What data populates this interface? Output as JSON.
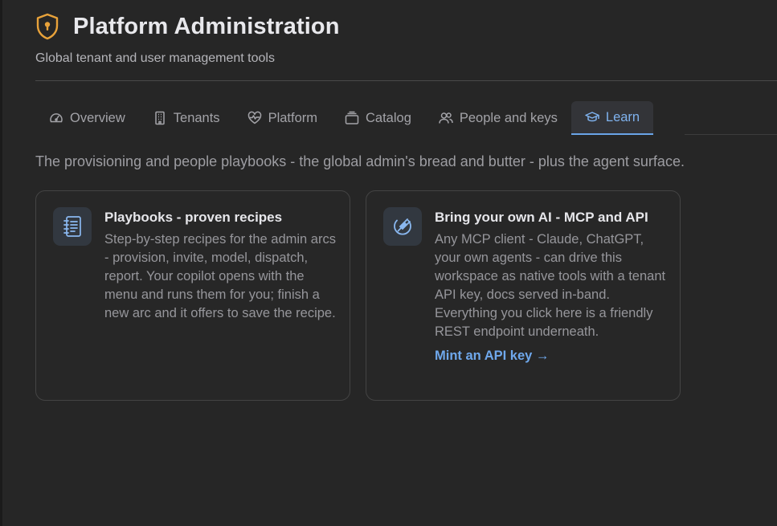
{
  "header": {
    "title": "Platform Administration",
    "subtitle": "Global tenant and user management tools",
    "icon": "shield-keyhole-icon",
    "accent_color": "#e8a23a"
  },
  "tabs": [
    {
      "label": "Overview",
      "icon": "gauge-icon",
      "active": false
    },
    {
      "label": "Tenants",
      "icon": "building-icon",
      "active": false
    },
    {
      "label": "Platform",
      "icon": "heart-pulse-icon",
      "active": false
    },
    {
      "label": "Catalog",
      "icon": "layers-icon",
      "active": false
    },
    {
      "label": "People and keys",
      "icon": "users-icon",
      "active": false
    },
    {
      "label": "Learn",
      "icon": "graduation-cap-icon",
      "active": true
    }
  ],
  "intro": "The provisioning and people playbooks - the global admin's bread and butter - plus the agent surface.",
  "cards": [
    {
      "icon": "notebook-icon",
      "title": "Playbooks - proven recipes",
      "text": "Step-by-step recipes for the admin arcs - provision, invite, model, dispatch, report. Your copilot opens with the menu and runs them for you; finish a new arc and it offers to save the recipe."
    },
    {
      "icon": "plug-icon",
      "title": "Bring your own AI - MCP and API",
      "text": "Any MCP client - Claude, ChatGPT, your own agents - can drive this workspace as native tools with a tenant API key, docs served in-band. Everything you click here is a friendly REST endpoint underneath.",
      "link": "Mint an API key →"
    }
  ],
  "colors": {
    "background": "#262626",
    "active_tab": "#7fb2ee",
    "link": "#6fa8ec",
    "icon_blue": "#8ab8f0"
  }
}
